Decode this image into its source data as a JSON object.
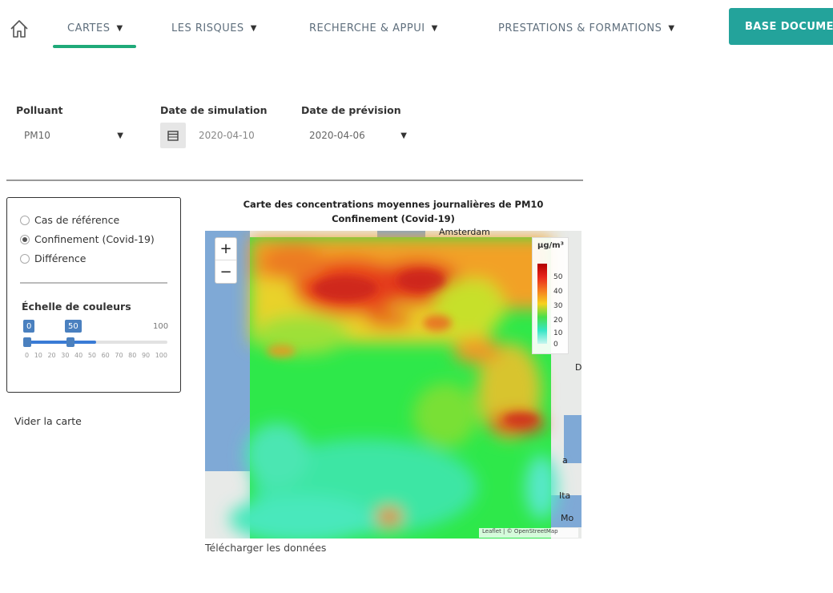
{
  "nav": {
    "items": [
      {
        "label": "CARTES",
        "active": true
      },
      {
        "label": "LES RISQUES",
        "active": false
      },
      {
        "label": "RECHERCHE & APPUI",
        "active": false
      },
      {
        "label": "PRESTATIONS & FORMATIONS",
        "active": false
      }
    ],
    "cta_label": "BASE DOCUMEN"
  },
  "form": {
    "polluant_label": "Polluant",
    "polluant_value": "PM10",
    "simulation_label": "Date de simulation",
    "simulation_value": "2020-04-10",
    "prevision_label": "Date de prévision",
    "prevision_value": "2020-04-06"
  },
  "panel": {
    "options": [
      {
        "label": "Cas de référence",
        "checked": false
      },
      {
        "label": "Confinement (Covid-19)",
        "checked": true
      },
      {
        "label": "Différence",
        "checked": false
      }
    ],
    "scale_title": "Échelle de couleurs",
    "slider": {
      "min_tag": "0",
      "max_tag": "50",
      "end_label": "100",
      "range_low": 0,
      "range_high": 50
    },
    "tick_labels": [
      "0",
      "10",
      "20",
      "30",
      "40",
      "50",
      "60",
      "70",
      "80",
      "90",
      "100"
    ]
  },
  "clear_link": "Vider la carte",
  "map": {
    "title_line1": "Carte des concentrations moyennes journalières de PM10",
    "title_line2": "Confinement (Covid-19)",
    "place_amsterdam": "Amsterdam",
    "place_d": "D",
    "place_a": "a",
    "place_ita": "Ita",
    "place_mo": "Mo",
    "legend_unit": "µg/m³",
    "legend_ticks": [
      "50",
      "40",
      "30",
      "20",
      "10",
      "0"
    ],
    "attribution": "Leaflet | © OpenStreetMap",
    "zoom_in": "+",
    "zoom_out": "−"
  },
  "download_link": "Télécharger les données"
}
